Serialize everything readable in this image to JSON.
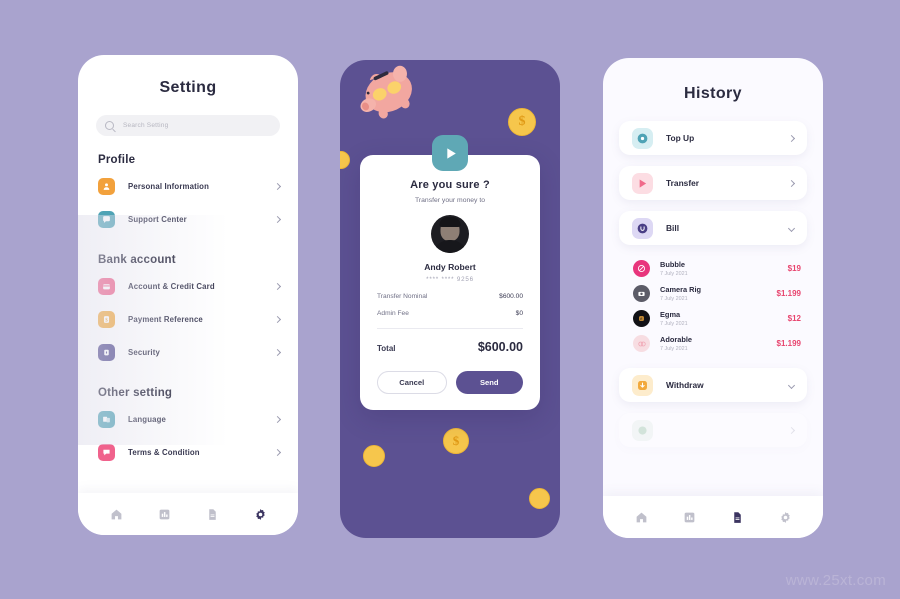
{
  "background_color": "#a9a3ce",
  "watermark": "www.25xt.com",
  "screen1": {
    "title": "Setting",
    "search": {
      "placeholder": "Search Setting",
      "icon": "search-icon"
    },
    "sections": [
      {
        "heading": "Profile",
        "items": [
          {
            "label": "Personal Information",
            "icon": "person-icon",
            "color": "#f2a13c",
            "chevron": "chevron-right-icon"
          },
          {
            "label": "Support Center",
            "icon": "chat-icon",
            "color": "#4fa3b5",
            "chevron": "chevron-right-icon"
          }
        ]
      },
      {
        "heading": "Bank account",
        "items": [
          {
            "label": "Account & Credit Card",
            "icon": "credit-card-icon",
            "color": "#f0628c",
            "chevron": "chevron-right-icon"
          },
          {
            "label": "Payment Reference",
            "icon": "dollar-icon",
            "color": "#f2a93c",
            "chevron": "chevron-right-icon"
          },
          {
            "label": "Security",
            "icon": "lock-icon",
            "color": "#514a8e",
            "chevron": "chevron-right-icon"
          }
        ]
      },
      {
        "heading": "Other setting",
        "items": [
          {
            "label": "Language",
            "icon": "language-icon",
            "color": "#4fa3b5",
            "chevron": "chevron-right-icon"
          },
          {
            "label": "Terms & Condition",
            "icon": "terms-icon",
            "color": "#f0628c",
            "chevron": "chevron-right-icon"
          }
        ]
      }
    ],
    "nav": [
      {
        "icon": "home-icon",
        "active": false
      },
      {
        "icon": "chart-icon",
        "active": false
      },
      {
        "icon": "document-icon",
        "active": false
      },
      {
        "icon": "gear-icon",
        "active": true
      }
    ]
  },
  "screen2": {
    "badge_icon": "play-icon",
    "title": "Are you sure ?",
    "subtitle": "Transfer your money to",
    "avatar": "user-avatar",
    "recipient_name": "Andy Robert",
    "card_number": "**** **** 9256",
    "lines": [
      {
        "key": "Transfer Nominal",
        "value": "$600.00"
      },
      {
        "key": "Admin Fee",
        "value": "$0"
      }
    ],
    "total_label": "Total",
    "total_value": "$600.00",
    "cancel_label": "Cancel",
    "send_label": "Send",
    "decorations": {
      "piggy": "piggy-bank-icon",
      "coin_symbol": "$"
    }
  },
  "screen3": {
    "title": "History",
    "categories": [
      {
        "label": "Top Up",
        "icon": "topup-icon",
        "color": "#4fa3b5",
        "bg": "#d6eef2",
        "chevron": "chevron-right-icon",
        "expanded": false
      },
      {
        "label": "Transfer",
        "icon": "transfer-icon",
        "color": "#f06a8a",
        "bg": "#fcdde3",
        "chevron": "chevron-right-icon",
        "expanded": false
      },
      {
        "label": "Bill",
        "icon": "bill-icon",
        "color": "#4a3f86",
        "bg": "#ddd8f4",
        "chevron": "chevron-down-icon",
        "expanded": true
      },
      {
        "label": "Withdraw",
        "icon": "withdraw-icon",
        "color": "#f2a93c",
        "bg": "#fdeccc",
        "chevron": "chevron-down-icon",
        "expanded": false
      }
    ],
    "transactions": [
      {
        "name": "Bubble",
        "date": "7 July 2021",
        "amount": "$19",
        "icon": "bubble-icon",
        "color": "#e8357c"
      },
      {
        "name": "Camera Rig",
        "date": "7 July 2021",
        "amount": "$1.199",
        "icon": "camera-icon",
        "color": "#5c5c68"
      },
      {
        "name": "Egma",
        "date": "7 July 2021",
        "amount": "$12",
        "icon": "egma-icon",
        "color": "#111116"
      },
      {
        "name": "Adorable",
        "date": "7 July 2021",
        "amount": "$1.199",
        "icon": "adorable-icon",
        "color": "#f3c6cf"
      }
    ],
    "nav": [
      {
        "icon": "home-icon",
        "active": false
      },
      {
        "icon": "chart-icon",
        "active": false
      },
      {
        "icon": "document-icon",
        "active": true
      },
      {
        "icon": "gear-icon",
        "active": false
      }
    ]
  }
}
